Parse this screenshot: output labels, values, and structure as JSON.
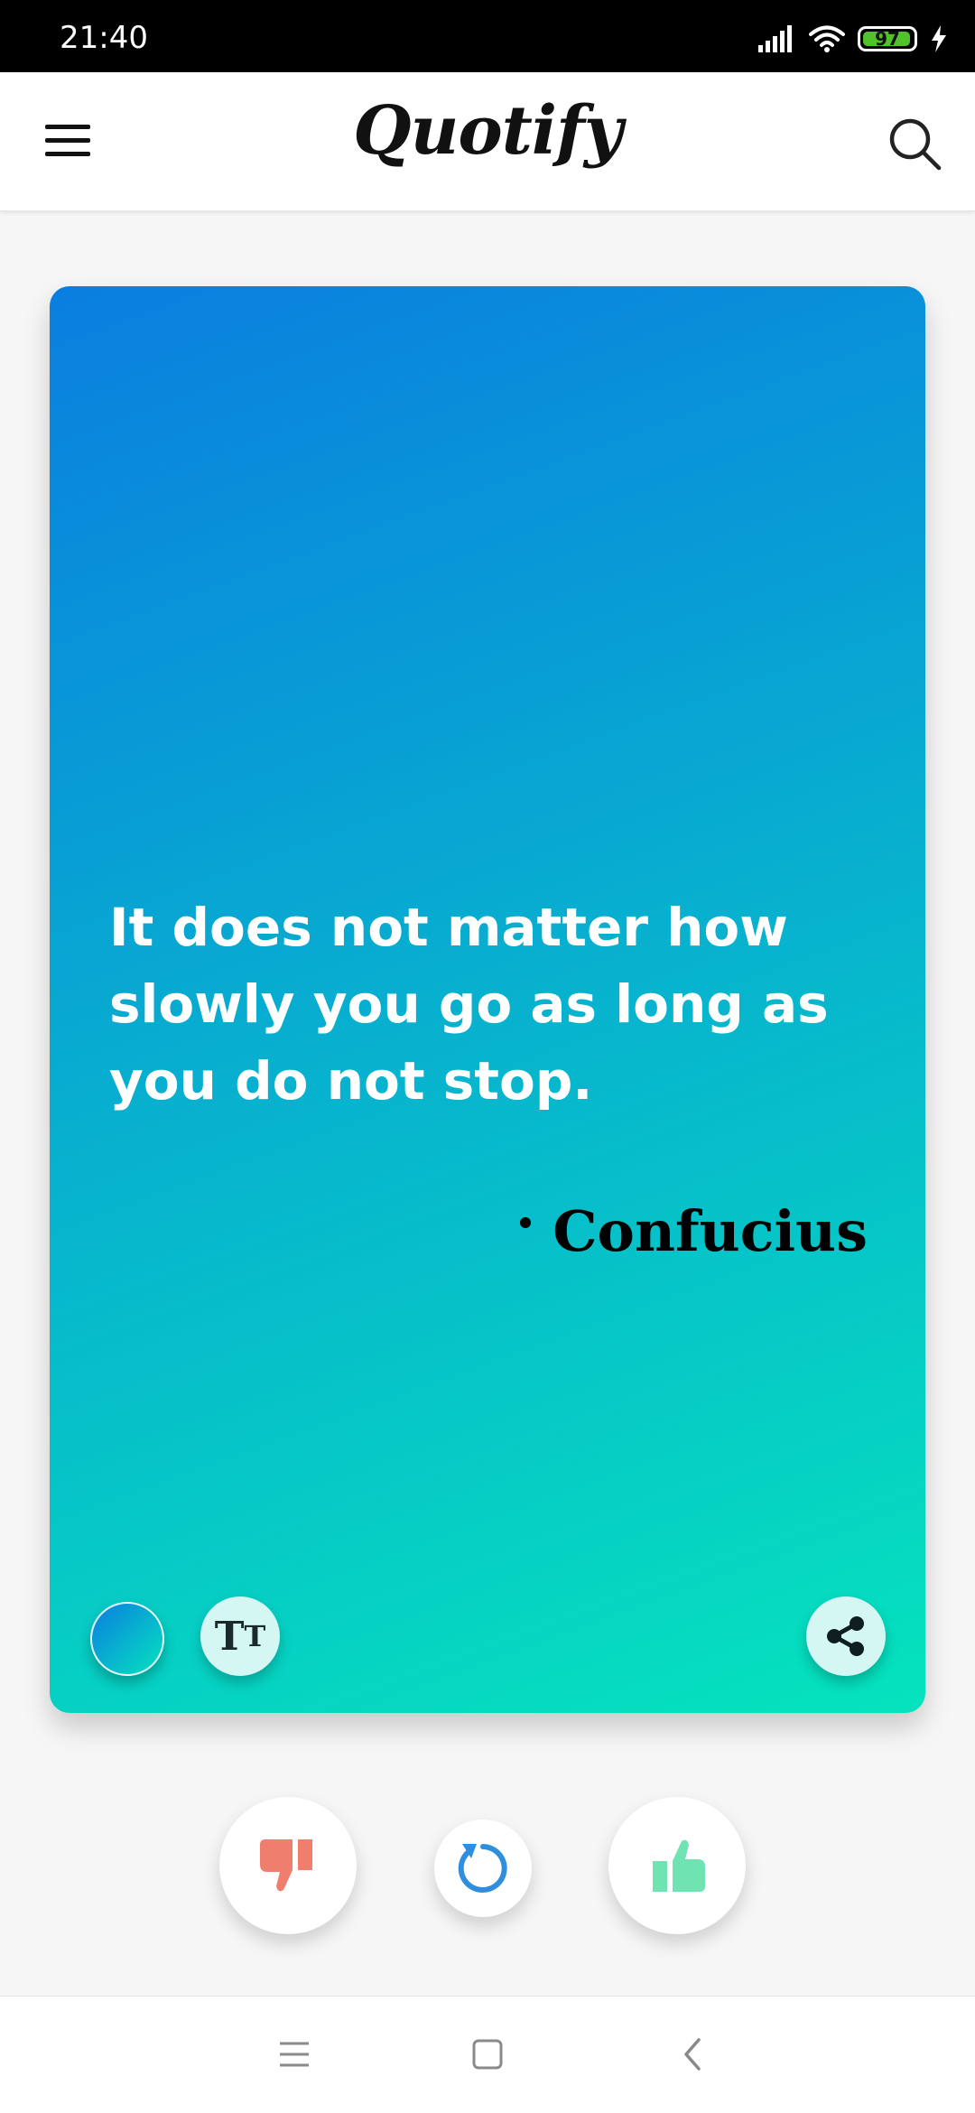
{
  "status_bar": {
    "time": "21:40",
    "battery_level": 97,
    "battery_label": "97"
  },
  "app_bar": {
    "title": "Quotify"
  },
  "quote": {
    "text": "It does not matter how slowly you go as long as you do not stop.",
    "author": "Confucius",
    "gradient": {
      "start": "#0a7ee0",
      "end": "#05e3bd"
    }
  },
  "card_actions": {
    "font_toggle_glyph_big": "T",
    "font_toggle_glyph_small": "T"
  },
  "colors": {
    "dislike": "#ef7f6c",
    "refresh": "#2f8fdc",
    "like": "#6fe3b2",
    "share_bg": "#d5f7f3"
  }
}
